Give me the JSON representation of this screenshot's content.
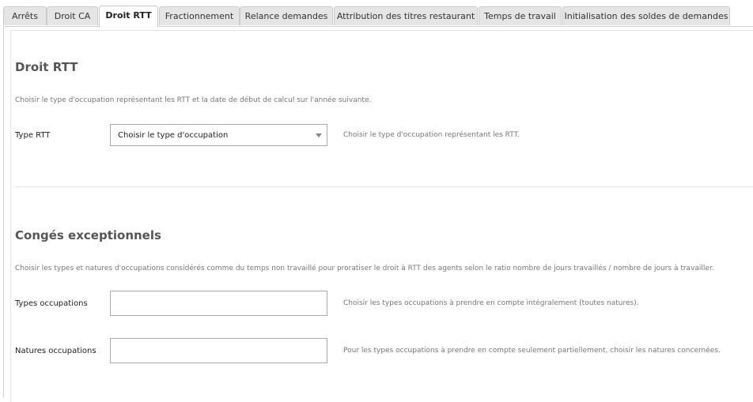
{
  "tabs": [
    {
      "label": "Arrêts",
      "active": false
    },
    {
      "label": "Droit CA",
      "active": false
    },
    {
      "label": "Droit RTT",
      "active": true
    },
    {
      "label": "Fractionnement",
      "active": false
    },
    {
      "label": "Relance demandes",
      "active": false
    },
    {
      "label": "Attribution des titres restaurant",
      "active": false
    },
    {
      "label": "Temps de travail",
      "active": false
    },
    {
      "label": "Initialisation des soldes de demandes",
      "active": false
    }
  ],
  "droit_rtt": {
    "title": "Droit RTT",
    "description": "Choisir le type d'occupation représentant les RTT et la date de début de calcul sur l'année suivante.",
    "type_rtt": {
      "label": "Type RTT",
      "selected": "Choisir le type d'occupation",
      "help": "Choisir le type d'occupation représentant les RTT."
    }
  },
  "conges": {
    "title": "Congés exceptionnels",
    "description": "Choisir les types et natures d'occupations considérés comme du temps non travaillé pour proratiser le droit à RTT des agents selon le ratio nombre de jours travaillés / nombre de jours à travailler.",
    "types_occupations": {
      "label": "Types occupations",
      "value": "",
      "help": "Choisir les types occupations à prendre en compte intégralement (toutes natures)."
    },
    "natures_occupations": {
      "label": "Natures occupations",
      "value": "",
      "help": "Pour les types occupations à prendre en compte seulement partiellement, choisir les natures concernées."
    }
  },
  "colors": {
    "tab_bg": "#e5e5e5",
    "tab_active_bg": "#ffffff",
    "title": "#555555",
    "muted_text": "#777777"
  }
}
